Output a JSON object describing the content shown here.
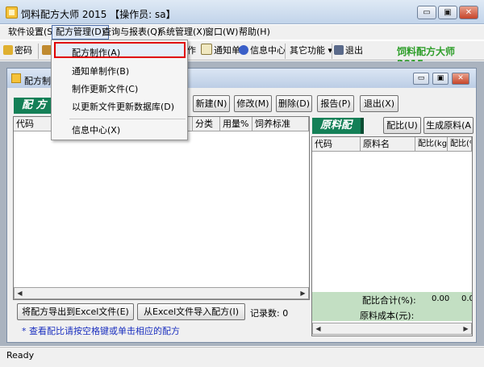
{
  "window": {
    "title": "饲料配方大师 2015  【操作员: sa】",
    "btn_min": "▭",
    "btn_max": "▣",
    "btn_close": "✕"
  },
  "menu": [
    "软件设置(S)",
    "配方管理(D)",
    "查询与报表(Q)",
    "系统管理(X)",
    "窗口(W)",
    "帮助(H)"
  ],
  "dropdown": {
    "items": [
      "配方制作(A)",
      "通知单制作(B)",
      "制作更新文件(C)",
      "以更新文件更新数据库(D)",
      "信息中心(X)"
    ],
    "highlighted_index": 0
  },
  "toolbar": {
    "items": [
      "密码",
      "作",
      "通知单",
      "信息中心",
      "其它功能",
      "退出"
    ],
    "dropdown_arrow": "▾",
    "brand": "饲料配方大师  2015"
  },
  "child": {
    "title": "配方制作",
    "section_label": "配 方",
    "buttons": [
      "新建(N)",
      "修改(M)",
      "删除(D)",
      "报告(P)",
      "退出(X)"
    ],
    "left_columns": [
      "代码",
      "分类",
      "用量%",
      "饲养标准"
    ],
    "right_section_label": "原料配比",
    "right_buttons": [
      "配比(U)",
      "生成原料(A"
    ],
    "right_columns": [
      "代码",
      "原料名",
      "配比(kg)",
      "配比(%"
    ],
    "sum_label": "配比合计(%):",
    "sum_values": [
      "0.00",
      "0.0"
    ],
    "cost_label": "原料成本(元):",
    "export_button": "将配方导出到Excel文件(E)",
    "import_button": "从Excel文件导入配方(I)",
    "record_count": "记录数: 0",
    "hint": "* 查看配比请按空格键或单击相应的配方"
  },
  "status": "Ready",
  "colors": {
    "accent_green": "#148057",
    "brand_green": "#2e9e2a",
    "highlight_red": "#e00000",
    "hint_blue": "#1a2fbf"
  }
}
